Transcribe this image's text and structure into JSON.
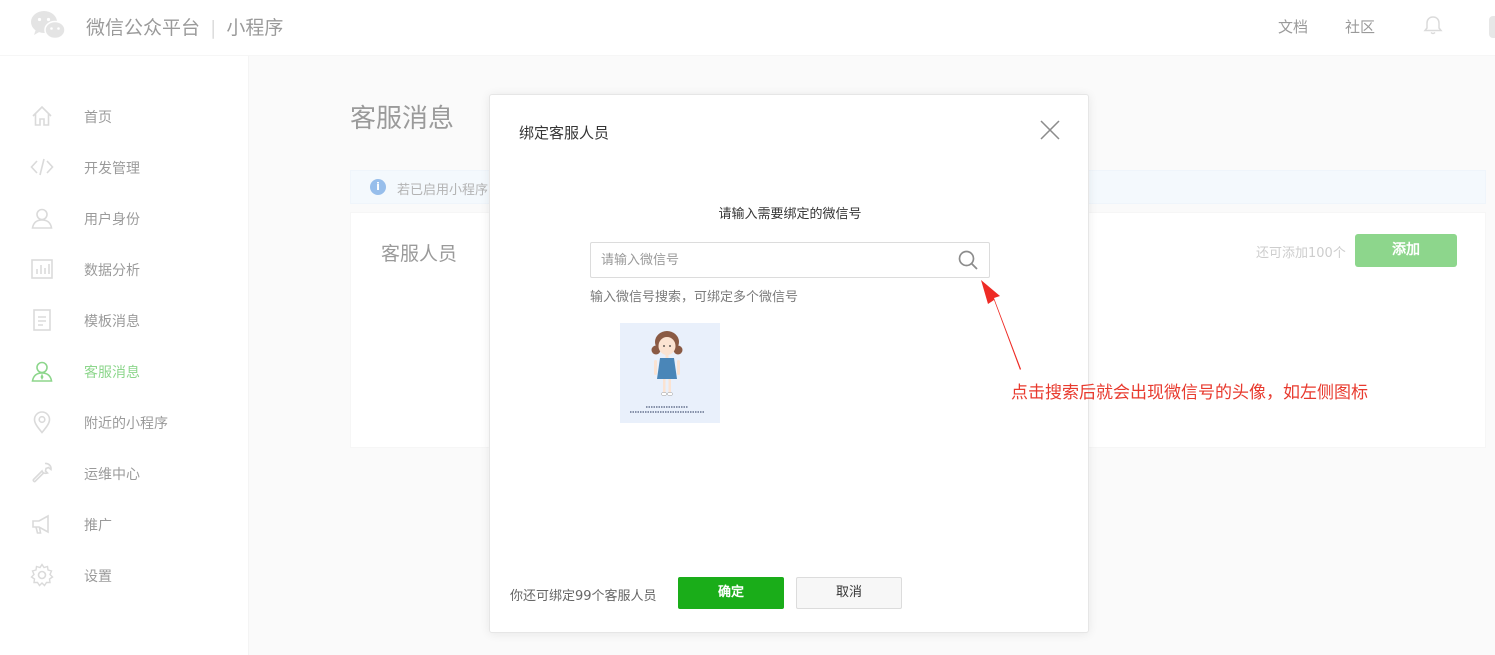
{
  "header": {
    "brand": "微信公众平台",
    "separator": "|",
    "product": "小程序",
    "links": [
      "文档",
      "社区"
    ]
  },
  "sidebar": {
    "items": [
      {
        "label": "首页",
        "icon": "home-icon"
      },
      {
        "label": "开发管理",
        "icon": "code-icon"
      },
      {
        "label": "用户身份",
        "icon": "user-icon"
      },
      {
        "label": "数据分析",
        "icon": "chart-icon"
      },
      {
        "label": "模板消息",
        "icon": "document-icon"
      },
      {
        "label": "客服消息",
        "icon": "customer-service-icon",
        "active": true
      },
      {
        "label": "附近的小程序",
        "icon": "location-icon"
      },
      {
        "label": "运维中心",
        "icon": "wrench-icon"
      },
      {
        "label": "推广",
        "icon": "megaphone-icon"
      },
      {
        "label": "设置",
        "icon": "settings-icon"
      }
    ]
  },
  "main": {
    "title": "客服消息",
    "notice": "若已启用小程序",
    "card_title": "客服人员",
    "remaining": "还可添加100个",
    "add_label": "添加"
  },
  "dialog": {
    "title": "绑定客服人员",
    "prompt": "请输入需要绑定的微信号",
    "search_placeholder": "请输入微信号",
    "search_value": "",
    "hint": "输入微信号搜索，可绑定多个微信号",
    "remaining": "你还可绑定99个客服人员",
    "confirm_label": "确定",
    "cancel_label": "取消"
  },
  "annotation": {
    "text": "点击搜索后就会出现微信号的头像，如左侧图标"
  },
  "colors": {
    "primary": "#1aad19",
    "annotation": "#e83a2e",
    "notice_bg": "#e9f2fb"
  }
}
